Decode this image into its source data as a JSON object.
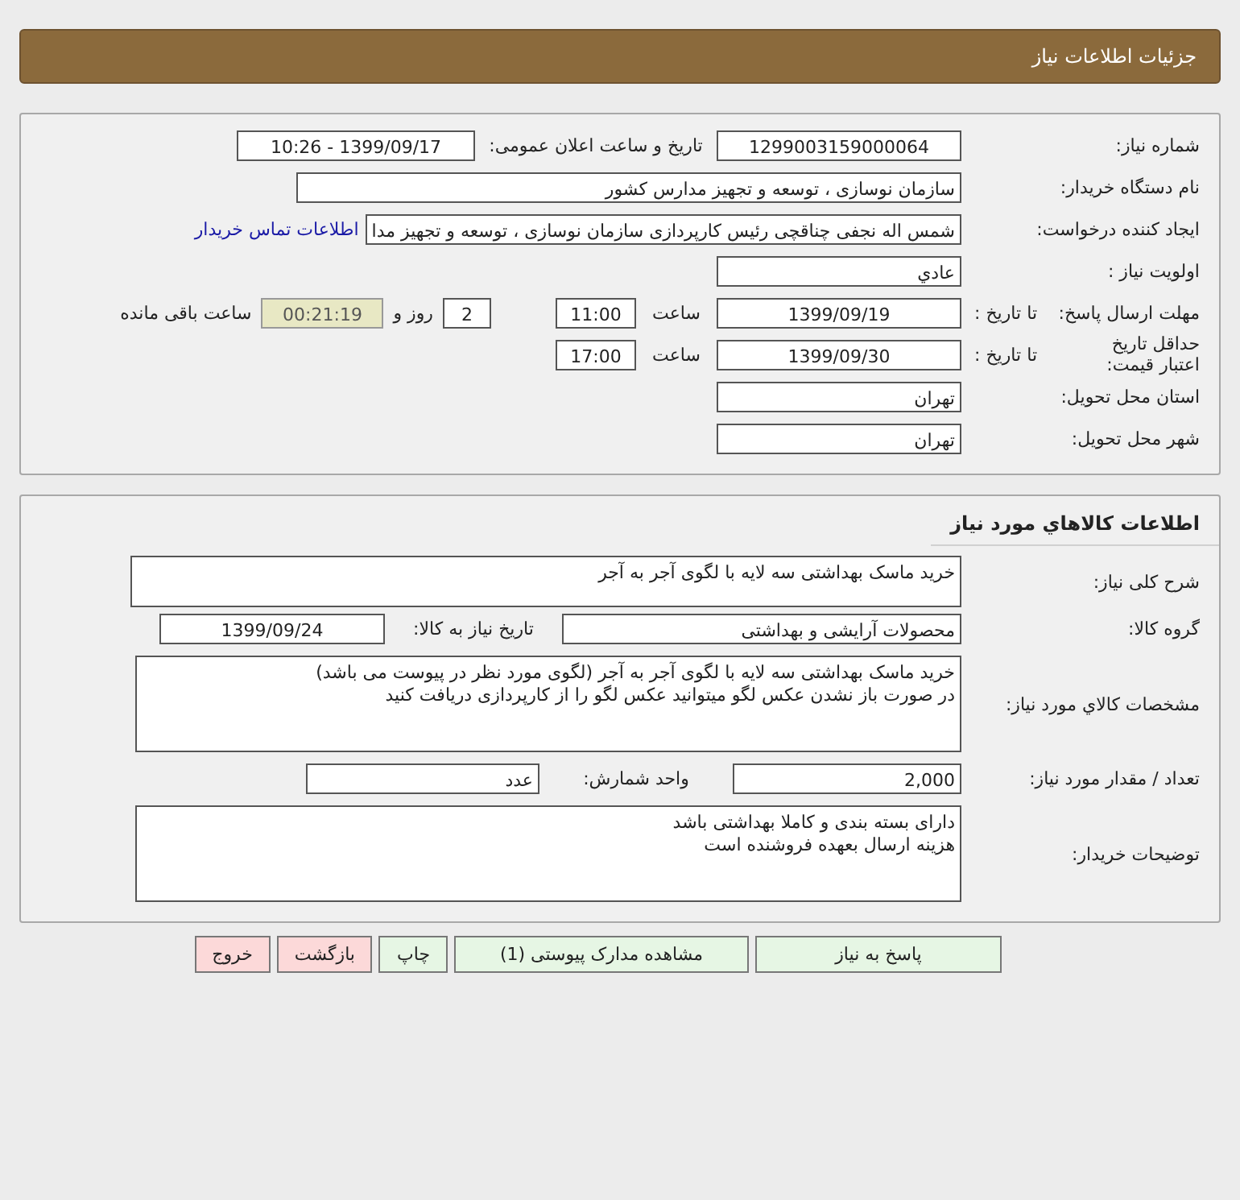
{
  "header": {
    "title": "جزئیات اطلاعات نیاز"
  },
  "need_info": {
    "need_number": {
      "label": "شماره نیاز:",
      "value": "1299003159000064"
    },
    "announce": {
      "label": "تاریخ و ساعت اعلان عمومی:",
      "value": "1399/09/17 - 10:26"
    },
    "buyer_org": {
      "label": "نام دستگاه خریدار:",
      "value": "سازمان نوسازی ، توسعه و تجهیز مدارس کشور"
    },
    "requester": {
      "label": "ایجاد کننده درخواست:",
      "value": "شمس اله نجفی چناقچی رئیس کارپردازی سازمان نوسازی ، توسعه و تجهیز مدا",
      "link": "اطلاعات تماس خریدار"
    },
    "priority": {
      "label": "اولویت نیاز :",
      "value": "عادي"
    },
    "deadline": {
      "label": "مهلت ارسال پاسخ:",
      "to_label": "تا تاریخ :",
      "date": "1399/09/19",
      "time_label": "ساعت",
      "time": "11:00",
      "days": "2",
      "days_label": "روز و",
      "remaining": "00:21:19",
      "remaining_label": "ساعت باقی مانده"
    },
    "validity": {
      "label": "حداقل تاریخ اعتبار قیمت:",
      "to_label": "تا تاریخ :",
      "date": "1399/09/30",
      "time_label": "ساعت",
      "time": "17:00"
    },
    "province": {
      "label": "استان محل تحویل:",
      "value": "تهران"
    },
    "city": {
      "label": "شهر محل تحویل:",
      "value": "تهران"
    }
  },
  "goods": {
    "title": "اطلاعات کالاهاي مورد نياز",
    "summary": {
      "label": "شرح کلی نیاز:",
      "value": "خرید ماسک بهداشتی سه لایه با لگوی آجر به آجر"
    },
    "group": {
      "label": "گروه کالا:",
      "value": "محصولات آرایشی و بهداشتی"
    },
    "need_date": {
      "label": "تاریخ نیاز به کالا:",
      "value": "1399/09/24"
    },
    "specs": {
      "label": "مشخصات کالاي مورد نياز:",
      "lines": [
        "خرید ماسک بهداشتی سه لایه با لگوی آجر به آجر (لگوی مورد نظر در پیوست می باشد)",
        "در صورت باز نشدن عکس لگو میتوانید عکس لگو را از کارپردازی دریافت کنید"
      ]
    },
    "quantity": {
      "label": "تعداد / مقدار مورد نیاز:",
      "value": "2,000"
    },
    "unit": {
      "label": "واحد شمارش:",
      "value": "عدد"
    },
    "notes": {
      "label": "توضیحات خریدار:",
      "lines": [
        "دارای بسته بندی و کاملا بهداشتی باشد",
        "هزینه ارسال بعهده فروشنده است"
      ]
    }
  },
  "buttons": [
    {
      "label": "پاسخ به نیاز",
      "kind": "primary"
    },
    {
      "label": "مشاهده مدارک پیوستی (1)",
      "kind": "primary"
    },
    {
      "label": "چاپ",
      "kind": "primary"
    },
    {
      "label": "بازگشت",
      "kind": "danger"
    },
    {
      "label": "خروج",
      "kind": "danger"
    }
  ]
}
